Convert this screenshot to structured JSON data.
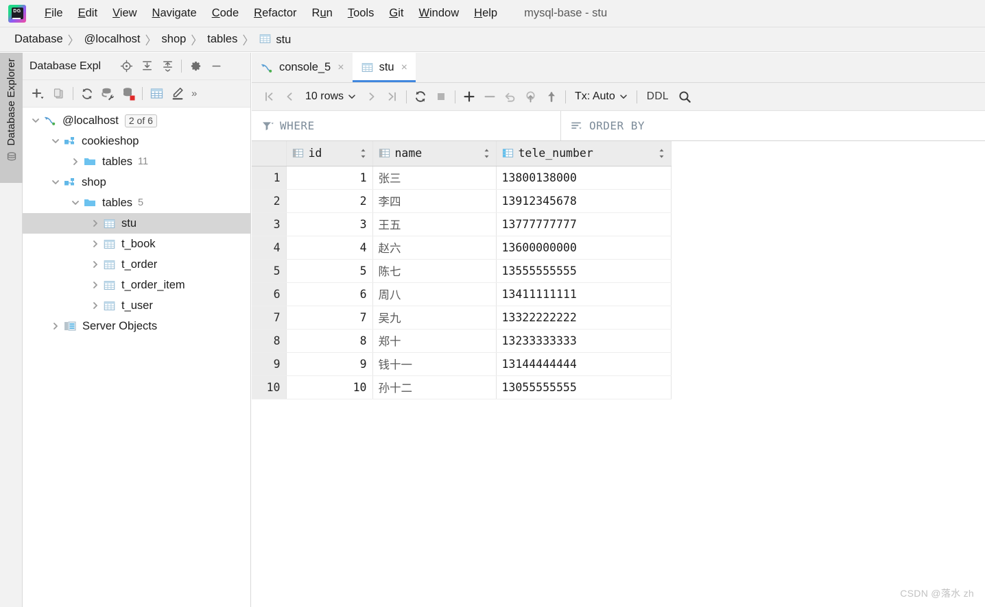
{
  "window": {
    "title": "mysql-base - stu"
  },
  "menu": {
    "items": [
      {
        "label": "File",
        "mnemonic": "F"
      },
      {
        "label": "Edit",
        "mnemonic": "E"
      },
      {
        "label": "View",
        "mnemonic": "V"
      },
      {
        "label": "Navigate",
        "mnemonic": "N"
      },
      {
        "label": "Code",
        "mnemonic": "C"
      },
      {
        "label": "Refactor",
        "mnemonic": "R"
      },
      {
        "label": "Run",
        "mnemonic": "u"
      },
      {
        "label": "Tools",
        "mnemonic": "T"
      },
      {
        "label": "Git",
        "mnemonic": "G"
      },
      {
        "label": "Window",
        "mnemonic": "W"
      },
      {
        "label": "Help",
        "mnemonic": "H"
      }
    ],
    "logo_text": "DG"
  },
  "breadcrumb": {
    "items": [
      "Database",
      "@localhost",
      "shop",
      "tables",
      "stu"
    ],
    "separator": "〉",
    "last_icon": "table-icon"
  },
  "left_strip": {
    "tab_label": "Database Explorer",
    "icon": "database-stack-icon"
  },
  "sidebar": {
    "title": "Database Expl",
    "toolbar_top": [
      {
        "name": "locate-icon",
        "tooltip": "Select Opened File"
      },
      {
        "name": "expand-all-icon",
        "tooltip": "Expand All"
      },
      {
        "name": "collapse-all-icon",
        "tooltip": "Collapse All"
      },
      {
        "name": "gear-icon",
        "tooltip": "Options"
      },
      {
        "name": "minimize-icon",
        "tooltip": "Hide"
      }
    ],
    "toolbar_main": [
      {
        "name": "add-icon",
        "tooltip": "New"
      },
      {
        "name": "copy-icon",
        "tooltip": "Duplicate"
      },
      {
        "name": "refresh-icon",
        "tooltip": "Refresh"
      },
      {
        "name": "datasource-properties-icon",
        "tooltip": "Data Source Properties"
      },
      {
        "name": "database-stop-icon",
        "tooltip": "Disconnect"
      },
      {
        "name": "table-icon",
        "tooltip": "Open Table Editor"
      },
      {
        "name": "edit-icon",
        "tooltip": "Modify"
      },
      {
        "name": "more-icon",
        "tooltip": "More"
      }
    ],
    "more_glyph": "»",
    "tree": [
      {
        "id": "localhost",
        "label": "@localhost",
        "badge": "2 of 6",
        "icon": "mysql-dolphin-icon",
        "indent": 0,
        "arrow": "down",
        "selected": false,
        "count": ""
      },
      {
        "id": "cookieshop",
        "label": "cookieshop",
        "badge": "",
        "icon": "schema-icon",
        "indent": 1,
        "arrow": "down",
        "selected": false,
        "count": ""
      },
      {
        "id": "cookieshop-tables",
        "label": "tables",
        "badge": "",
        "icon": "folder-icon",
        "indent": 2,
        "arrow": "right",
        "selected": false,
        "count": "11"
      },
      {
        "id": "shop",
        "label": "shop",
        "badge": "",
        "icon": "schema-icon",
        "indent": 1,
        "arrow": "down",
        "selected": false,
        "count": ""
      },
      {
        "id": "shop-tables",
        "label": "tables",
        "badge": "",
        "icon": "folder-icon",
        "indent": 2,
        "arrow": "down",
        "selected": false,
        "count": "5"
      },
      {
        "id": "stu",
        "label": "stu",
        "badge": "",
        "icon": "table-icon",
        "indent": 3,
        "arrow": "right",
        "selected": true,
        "count": ""
      },
      {
        "id": "t_book",
        "label": "t_book",
        "badge": "",
        "icon": "table-icon",
        "indent": 3,
        "arrow": "right",
        "selected": false,
        "count": ""
      },
      {
        "id": "t_order",
        "label": "t_order",
        "badge": "",
        "icon": "table-icon",
        "indent": 3,
        "arrow": "right",
        "selected": false,
        "count": ""
      },
      {
        "id": "t_order_item",
        "label": "t_order_item",
        "badge": "",
        "icon": "table-icon",
        "indent": 3,
        "arrow": "right",
        "selected": false,
        "count": ""
      },
      {
        "id": "t_user",
        "label": "t_user",
        "badge": "",
        "icon": "table-icon",
        "indent": 3,
        "arrow": "right",
        "selected": false,
        "count": ""
      },
      {
        "id": "server-objects",
        "label": "Server Objects",
        "badge": "",
        "icon": "server-objects-icon",
        "indent": 1,
        "arrow": "right",
        "selected": false,
        "count": ""
      }
    ]
  },
  "editor": {
    "tabs": [
      {
        "label": "console_5",
        "icon": "mysql-dolphin-icon",
        "active": false,
        "close": "×"
      },
      {
        "label": "stu",
        "icon": "table-icon",
        "active": true,
        "close": "×"
      }
    ]
  },
  "data_toolbar": {
    "first_page": "first-page-icon",
    "prev_page": "prev-page-icon",
    "rows_label": "10 rows",
    "next_page": "next-page-icon",
    "last_page": "last-page-icon",
    "refresh": "refresh-icon",
    "stop": "stop-icon",
    "add_row": "add-row-icon",
    "delete_row": "delete-row-icon",
    "revert": "revert-icon",
    "revert_selected": "revert-selected-icon",
    "submit": "submit-icon",
    "tx_label": "Tx: Auto",
    "ddl_label": "DDL",
    "search": "search-icon"
  },
  "filter_bar": {
    "where_label": "WHERE",
    "where_icon": "filter-icon",
    "order_by_label": "ORDER BY",
    "order_by_icon": "sort-icon"
  },
  "grid": {
    "columns": [
      {
        "key": "id",
        "label": "id",
        "icon": "column-icon",
        "highlight": false
      },
      {
        "key": "name",
        "label": "name",
        "icon": "column-icon",
        "highlight": false
      },
      {
        "key": "tele_number",
        "label": "tele_number",
        "icon": "column-icon",
        "highlight": true
      }
    ],
    "rows": [
      {
        "n": "1",
        "id": "1",
        "name": "张三",
        "tele_number": "13800138000"
      },
      {
        "n": "2",
        "id": "2",
        "name": "李四",
        "tele_number": "13912345678"
      },
      {
        "n": "3",
        "id": "3",
        "name": "王五",
        "tele_number": "13777777777"
      },
      {
        "n": "4",
        "id": "4",
        "name": "赵六",
        "tele_number": "13600000000"
      },
      {
        "n": "5",
        "id": "5",
        "name": "陈七",
        "tele_number": "13555555555"
      },
      {
        "n": "6",
        "id": "6",
        "name": "周八",
        "tele_number": "13411111111"
      },
      {
        "n": "7",
        "id": "7",
        "name": "吴九",
        "tele_number": "13322222222"
      },
      {
        "n": "8",
        "id": "8",
        "name": "郑十",
        "tele_number": "13233333333"
      },
      {
        "n": "9",
        "id": "9",
        "name": "钱十一",
        "tele_number": "13144444444"
      },
      {
        "n": "10",
        "id": "10",
        "name": "孙十二",
        "tele_number": "13055555555"
      }
    ]
  },
  "watermark": {
    "text": "CSDN @落水 zh"
  },
  "colors": {
    "accent": "#4187de",
    "toolbar_bg": "#f2f2f2",
    "selection": "#d6d6d6",
    "header_bg": "#ececec",
    "filter_text": "#7c8b99"
  }
}
